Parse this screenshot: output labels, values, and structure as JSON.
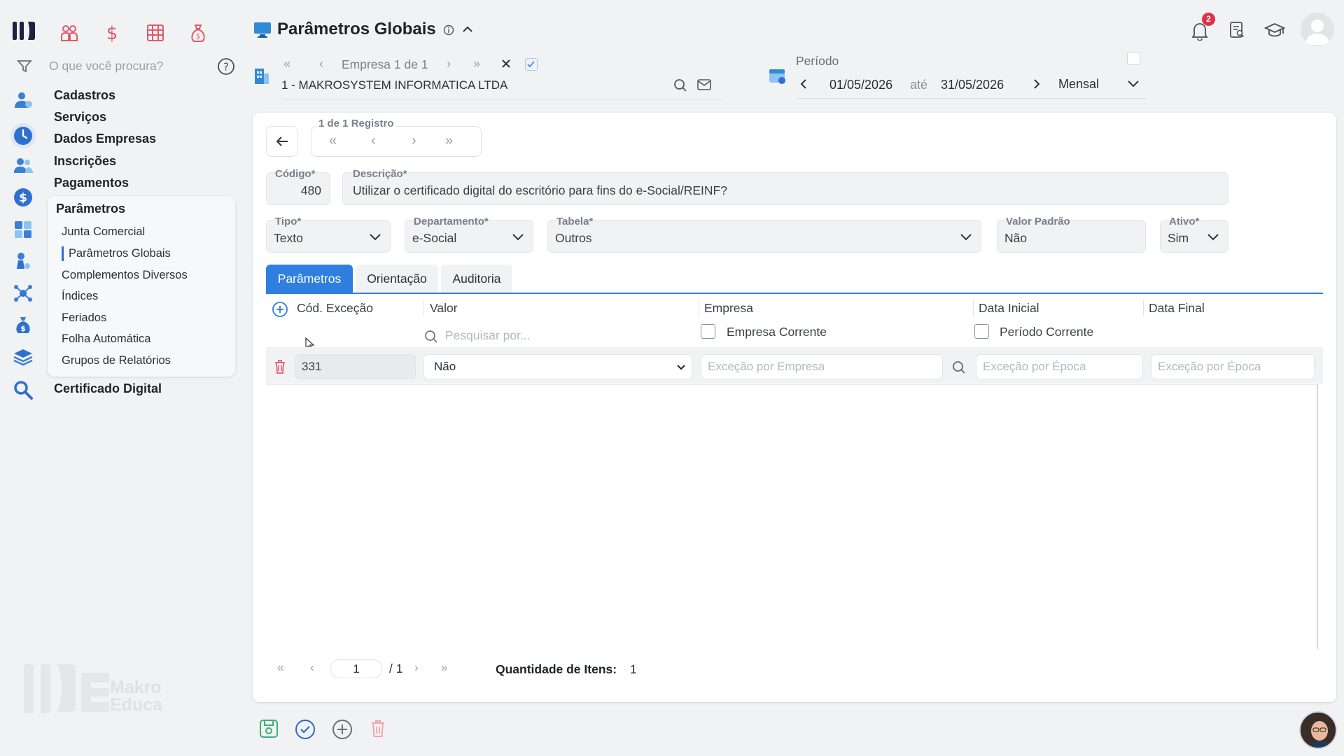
{
  "header": {
    "title": "Parâmetros Globais",
    "search_placeholder": "O que você procura?",
    "notification_count": "2"
  },
  "company_nav": {
    "counter": "Empresa 1 de 1",
    "company_name": "1 - MAKROSYSTEM INFORMATICA LTDA"
  },
  "period": {
    "label": "Período",
    "start": "01/05/2026",
    "separator": "até",
    "end": "31/05/2026",
    "mode": "Mensal"
  },
  "sidebar": {
    "menus": [
      {
        "label": "Cadastros"
      },
      {
        "label": "Serviços"
      },
      {
        "label": "Dados Empresas"
      },
      {
        "label": "Inscrições"
      },
      {
        "label": "Pagamentos"
      }
    ],
    "section": "Parâmetros",
    "submenu": [
      {
        "label": "Junta Comercial"
      },
      {
        "label": "Parâmetros Globais",
        "active": true
      },
      {
        "label": "Complementos Diversos"
      },
      {
        "label": "Índices"
      },
      {
        "label": "Feriados"
      },
      {
        "label": "Folha Automática"
      },
      {
        "label": "Grupos de Relatórios"
      }
    ],
    "last_menu": "Certificado Digital",
    "logo_text_1": "Makro",
    "logo_text_2": "Educa"
  },
  "record": {
    "counter": "1 de 1 Registro",
    "codigo_label": "Código*",
    "codigo": "480",
    "descricao_label": "Descrição*",
    "descricao": "Utilizar o certificado digital do escritório para fins do e-Social/REINF?",
    "tipo_label": "Tipo*",
    "tipo": "Texto",
    "departamento_label": "Departamento*",
    "departamento": "e-Social",
    "tabela_label": "Tabela*",
    "tabela": "Outros",
    "valor_padrao_label": "Valor Padrão",
    "valor_padrao": "Não",
    "ativo_label": "Ativo*",
    "ativo": "Sim"
  },
  "tabs": [
    {
      "label": "Parâmetros",
      "active": true
    },
    {
      "label": "Orientação"
    },
    {
      "label": "Auditoria"
    }
  ],
  "grid": {
    "columns": [
      "Cód. Exceção",
      "Valor",
      "Empresa",
      "Data Inicial",
      "Data Final"
    ],
    "search_placeholder": "Pesquisar por...",
    "empresa_corrente": "Empresa Corrente",
    "periodo_corrente": "Período Corrente",
    "row": {
      "codigo": "331",
      "valor": "Não",
      "empresa_placeholder": "Exceção por Empresa",
      "data_inicial_placeholder": "Exceção por Época",
      "data_final_placeholder": "Exceção por Época"
    }
  },
  "pagination": {
    "page": "1",
    "total": "/ 1",
    "qty_label": "Quantidade de Itens:",
    "qty_value": "1"
  }
}
